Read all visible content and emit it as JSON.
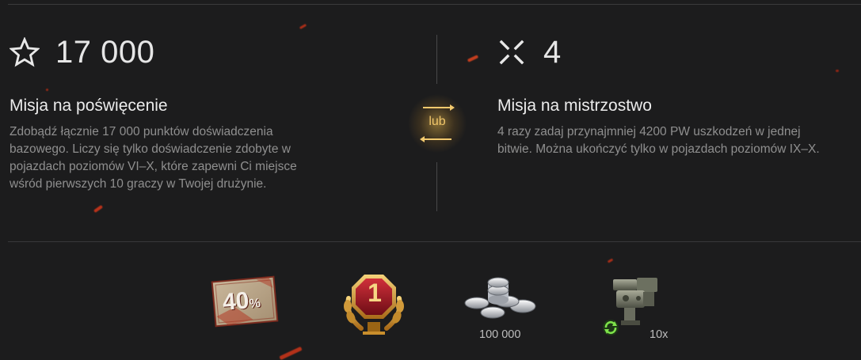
{
  "left_mission": {
    "score_icon": "star-outline-icon",
    "score": "17 000",
    "title": "Misja na poświęcenie",
    "description": "Zdobądź łącznie 17 000 punktów doświadczenia\nbazowego. Liczy się tylko doświadczenie zdobyte w\npojazdach poziomów VI–X, które zapewni Ci miejsce\nwśród pierwszych 10 graczy w Twojej drużynie."
  },
  "separator": {
    "label": "lub",
    "icon": "swap-arrows-icon"
  },
  "right_mission": {
    "score_icon": "crosshair-corners-icon",
    "score": "4",
    "title": "Misja na mistrzostwo",
    "description": "4 razy zadaj przynajmniej 4200 PW uszkodzeń w jednej\nbitwie. Można ukończyć tylko w pojazdach poziomów IX–X."
  },
  "rewards": [
    {
      "icon": "discount-card-icon",
      "card_text": "40",
      "card_suffix": "%",
      "label": ""
    },
    {
      "icon": "rank-badge-icon",
      "badge_text": "1",
      "label": ""
    },
    {
      "icon": "silver-coins-icon",
      "label": "100 000"
    },
    {
      "icon": "equipment-module-icon",
      "label": "10x"
    }
  ],
  "colors": {
    "background": "#1c1c1d",
    "accent_gold": "#f0c66a",
    "text_primary": "#ececec",
    "text_secondary": "#8f8f8f",
    "ember": "#c43a1c"
  }
}
